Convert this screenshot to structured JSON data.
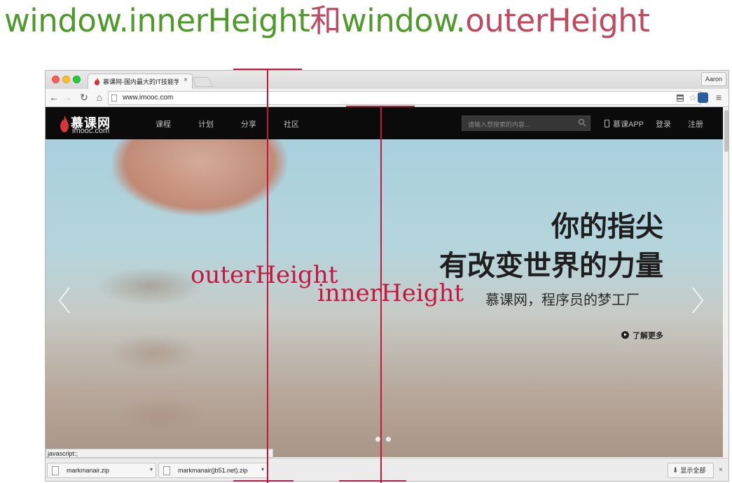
{
  "heading": {
    "part1": "window.innerHeight",
    "part2": "和",
    "part3": "window.",
    "part4": "outerHeight"
  },
  "browser": {
    "tab_title": "慕课网-国内最大的IT技能学",
    "tab_close": "×",
    "profile_name": "Aaron",
    "url": "www.imooc.com",
    "nav_back": "←",
    "nav_forward": "→",
    "nav_reload": "↻",
    "nav_home": "⌂",
    "star": "☆",
    "menu": "≡",
    "status_text": "javascript:;"
  },
  "site": {
    "logo_cn": "慕课网",
    "logo_en": "imooc.com",
    "nav": [
      "课程",
      "计划",
      "分享",
      "社区"
    ],
    "search_placeholder": "请输入想搜索的内容...",
    "app_link": "慕课APP",
    "login": "登录",
    "register": "注册"
  },
  "hero": {
    "headline_line1": "你的指尖",
    "headline_line2": "有改变世界的力量",
    "tagline": "慕课网，程序员的梦工厂",
    "learn_more": "了解更多",
    "slide_count": 2,
    "active_slide": 1
  },
  "downloads": {
    "items": [
      {
        "name": "markmanair.zip"
      },
      {
        "name": "markmanair(jb51.net).zip"
      }
    ],
    "show_all": "显示全部",
    "close": "×"
  },
  "annotations": {
    "outer_label": "outerHeight",
    "inner_label": "innerHeight"
  },
  "colors": {
    "heading_green": "#4f9a2a",
    "heading_pink": "#c0495f",
    "annotation_red": "#c5163f",
    "site_nav_bg": "#0b0b0b"
  }
}
